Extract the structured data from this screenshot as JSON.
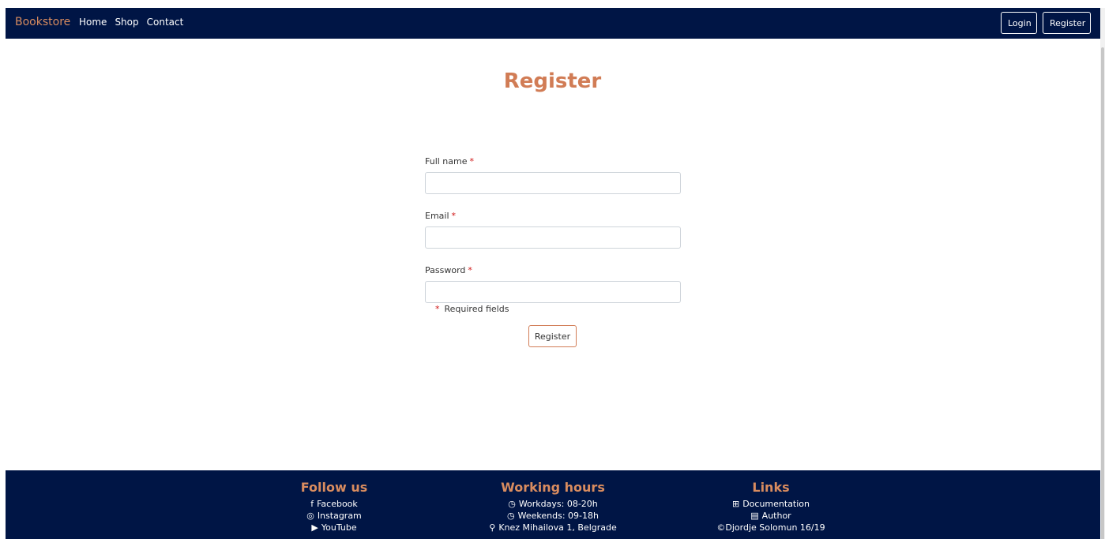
{
  "navbar": {
    "brand": "Bookstore",
    "links": [
      "Home",
      "Shop",
      "Contact"
    ],
    "login_label": "Login",
    "register_label": "Register"
  },
  "colors": {
    "navbar_bg": "#001545",
    "accent": "#d17c55",
    "required": "#d01515"
  },
  "main": {
    "title": "Register",
    "fields": [
      {
        "label": "Full name",
        "required_mark": "*",
        "value": ""
      },
      {
        "label": "Email",
        "required_mark": "*",
        "value": ""
      },
      {
        "label": "Password",
        "required_mark": "*",
        "value": ""
      }
    ],
    "required_note_mark": "*",
    "required_note": "Required fields",
    "submit_label": "Register"
  },
  "footer": {
    "follow": {
      "title": "Follow us",
      "items": [
        {
          "icon": "facebook-icon",
          "label": "Facebook"
        },
        {
          "icon": "instagram-icon",
          "label": "Instagram"
        },
        {
          "icon": "youtube-icon",
          "label": "YouTube"
        }
      ]
    },
    "hours": {
      "title": "Working hours",
      "items": [
        {
          "icon": "clock-icon",
          "label": "Workdays: 08-20h"
        },
        {
          "icon": "clock-icon",
          "label": "Weekends: 09-18h"
        },
        {
          "icon": "map-pin-icon",
          "label": "Knez Mihailova 1, Belgrade"
        }
      ]
    },
    "links": {
      "title": "Links",
      "items": [
        {
          "icon": "sitemap-icon",
          "label": "Documentation"
        },
        {
          "icon": "file-icon",
          "label": "Author"
        }
      ],
      "copyright": "©Djordje Solomun 16/19"
    }
  }
}
